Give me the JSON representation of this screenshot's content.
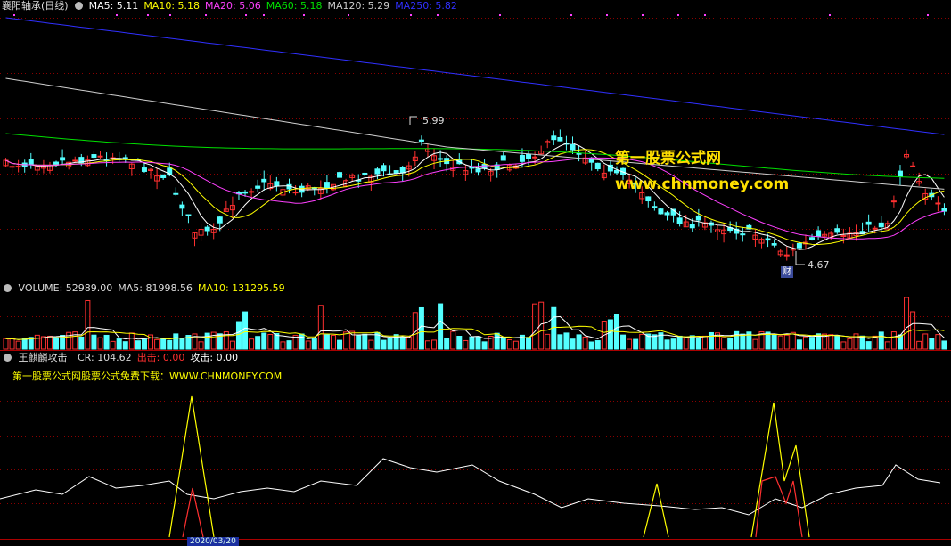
{
  "colors": {
    "up": "#ff3030",
    "down": "#54ffff",
    "white": "#ffffff",
    "yellow": "#ffff00",
    "magenta": "#ff40ff",
    "green": "#00e000",
    "blue": "#3030ff",
    "grid": "#8b0000",
    "panel_border": "#aa0000",
    "watermark": "#ffe000"
  },
  "main_panel": {
    "title": "襄阳轴承(日线)",
    "legend": [
      {
        "label": "MA5: 5.11",
        "color": "#ffffff"
      },
      {
        "label": "MA10: 5.18",
        "color": "#ffff00"
      },
      {
        "label": "MA20: 5.06",
        "color": "#ff40ff"
      },
      {
        "label": "MA60: 5.18",
        "color": "#00e000"
      },
      {
        "label": "MA120: 5.29",
        "color": "#cccccc"
      },
      {
        "label": "MA250: 5.82",
        "color": "#3030ff"
      }
    ],
    "high_label": "5.99",
    "low_label": "4.67",
    "cai_badge": "财",
    "watermark_title": "第一股票公式网",
    "watermark_url": "www.chnmoney.com"
  },
  "volume_panel": {
    "legend": [
      {
        "label": "VOLUME: 52989.00",
        "color": "#dddddd"
      },
      {
        "label": "MA5: 81998.56",
        "color": "#dddddd"
      },
      {
        "label": "MA10: 131295.59",
        "color": "#ffff00"
      }
    ]
  },
  "indicator_panel": {
    "name": "王麒麟攻击",
    "legend": [
      {
        "label": "CR: 104.62",
        "color": "#dddddd"
      },
      {
        "label": "出击: 0.00",
        "color": "#ff3030"
      },
      {
        "label": "攻击: 0.00",
        "color": "#ffffff"
      }
    ],
    "note": "第一股票公式网股票公式免费下载：WWW.CHNMONEY.COM",
    "date_tag": "2020/03/20"
  },
  "chart_data": {
    "type": "candlestick",
    "ma_periods": [
      5,
      10,
      20,
      60,
      120,
      250
    ],
    "ma_last": {
      "MA5": 5.11,
      "MA10": 5.18,
      "MA20": 5.06,
      "MA60": 5.18,
      "MA120": 5.29,
      "MA250": 5.82
    },
    "marked_high": 5.99,
    "marked_low": 4.67,
    "volume_last": 52989.0,
    "volume_ma5_last": 81998.56,
    "volume_ma10_last": 131295.59,
    "cr_last": 104.62,
    "chuji_last": 0.0,
    "gongji_last": 0.0
  }
}
